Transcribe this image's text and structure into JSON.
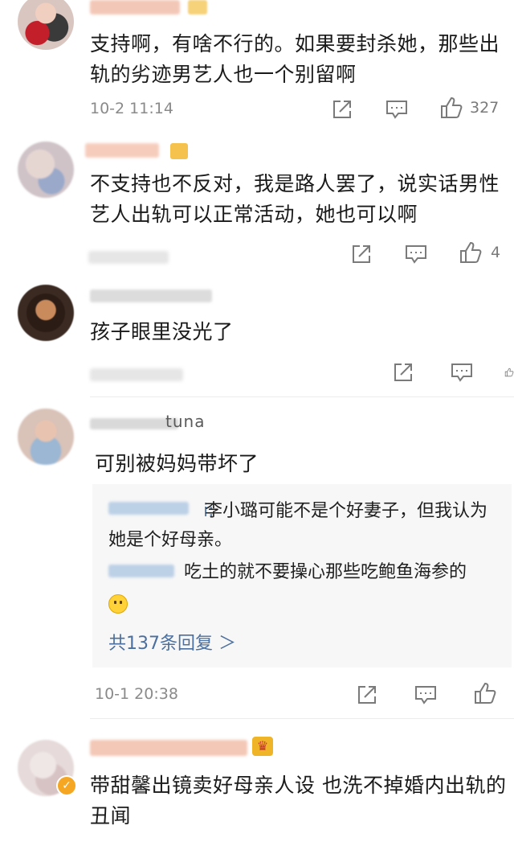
{
  "comments": [
    {
      "text": "支持啊，有啥不行的。如果要封杀她，那些出轨的劣迹男艺人也一个别留啊",
      "time": "10-2 11:14",
      "like_count": "327"
    },
    {
      "text": "不支持也不反对，我是路人罢了，说实话男性艺人出轨可以正常活动，她也可以啊",
      "time": "",
      "like_count": "4"
    },
    {
      "text": "孩子眼里没光了",
      "time": "",
      "like_count": ""
    },
    {
      "text": "可别被妈妈带坏了",
      "time": "10-1 20:38",
      "like_count": "",
      "replies": [
        {
          "name_suffix": "i",
          "sep": ":",
          "text": "李小璐可能不是个好妻子，但我认为她是个好母亲。"
        },
        {
          "name_suffix": "",
          "sep": "",
          "text": "吃土的就不要操心那些吃鲍鱼海参的"
        }
      ],
      "more_replies": "共137条回复 ＞"
    },
    {
      "text": "带甜馨出镜卖好母亲人设 也洗不掉婚内出轨的丑闻",
      "time": "",
      "like_count": ""
    }
  ],
  "partial_username": "tuna",
  "colors": {
    "accent_link": "#4b6f9e",
    "meta_gray": "#8a8a8a",
    "badge_gold": "#f0b429",
    "verified": "#f5a623"
  },
  "icons": [
    "share-icon",
    "comment-icon",
    "like-icon",
    "smiley-emoji-icon",
    "crown-badge-icon",
    "verified-badge-icon"
  ]
}
